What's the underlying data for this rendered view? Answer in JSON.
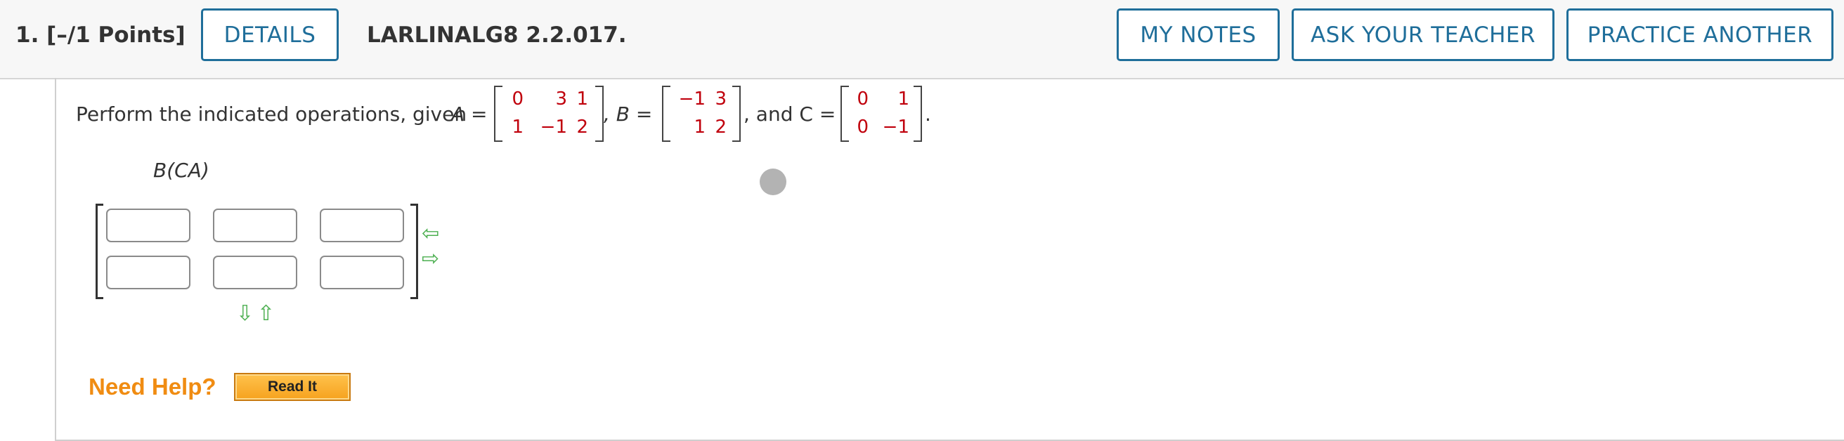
{
  "header": {
    "question_number": "1.",
    "points": "[–/1 Points]",
    "details_label": "DETAILS",
    "question_id": "LARLINALG8 2.2.017.",
    "my_notes_label": "MY NOTES",
    "ask_teacher_label": "ASK YOUR TEACHER",
    "practice_label": "PRACTICE ANOTHER"
  },
  "problem": {
    "prompt": "Perform the indicated operations, given",
    "A_label": "A =",
    "B_label": ", B =",
    "C_label": ", and C =",
    "end_punct": ".",
    "matrix_A": [
      [
        "0",
        "3",
        "1"
      ],
      [
        "1",
        "−1",
        "2"
      ]
    ],
    "matrix_B": [
      [
        "−1",
        "3"
      ],
      [
        "1",
        "2"
      ]
    ],
    "matrix_C": [
      [
        "0",
        "1"
      ],
      [
        "0",
        "−1"
      ]
    ],
    "expression": "B(CA)",
    "matrix_value_color": "#c0000c"
  },
  "answer": {
    "rows": 2,
    "cols": 3,
    "values": [
      [
        "",
        "",
        ""
      ],
      [
        "",
        "",
        ""
      ]
    ],
    "arrow_icons": [
      "left-arrow-icon",
      "right-arrow-icon",
      "down-arrow-icon",
      "up-arrow-icon"
    ]
  },
  "help": {
    "need_help": "Need Help?",
    "read_it": "Read It"
  },
  "colors": {
    "accent": "#1f6e9a",
    "help_orange": "#f08c12",
    "arrow_green": "#4caf50"
  }
}
